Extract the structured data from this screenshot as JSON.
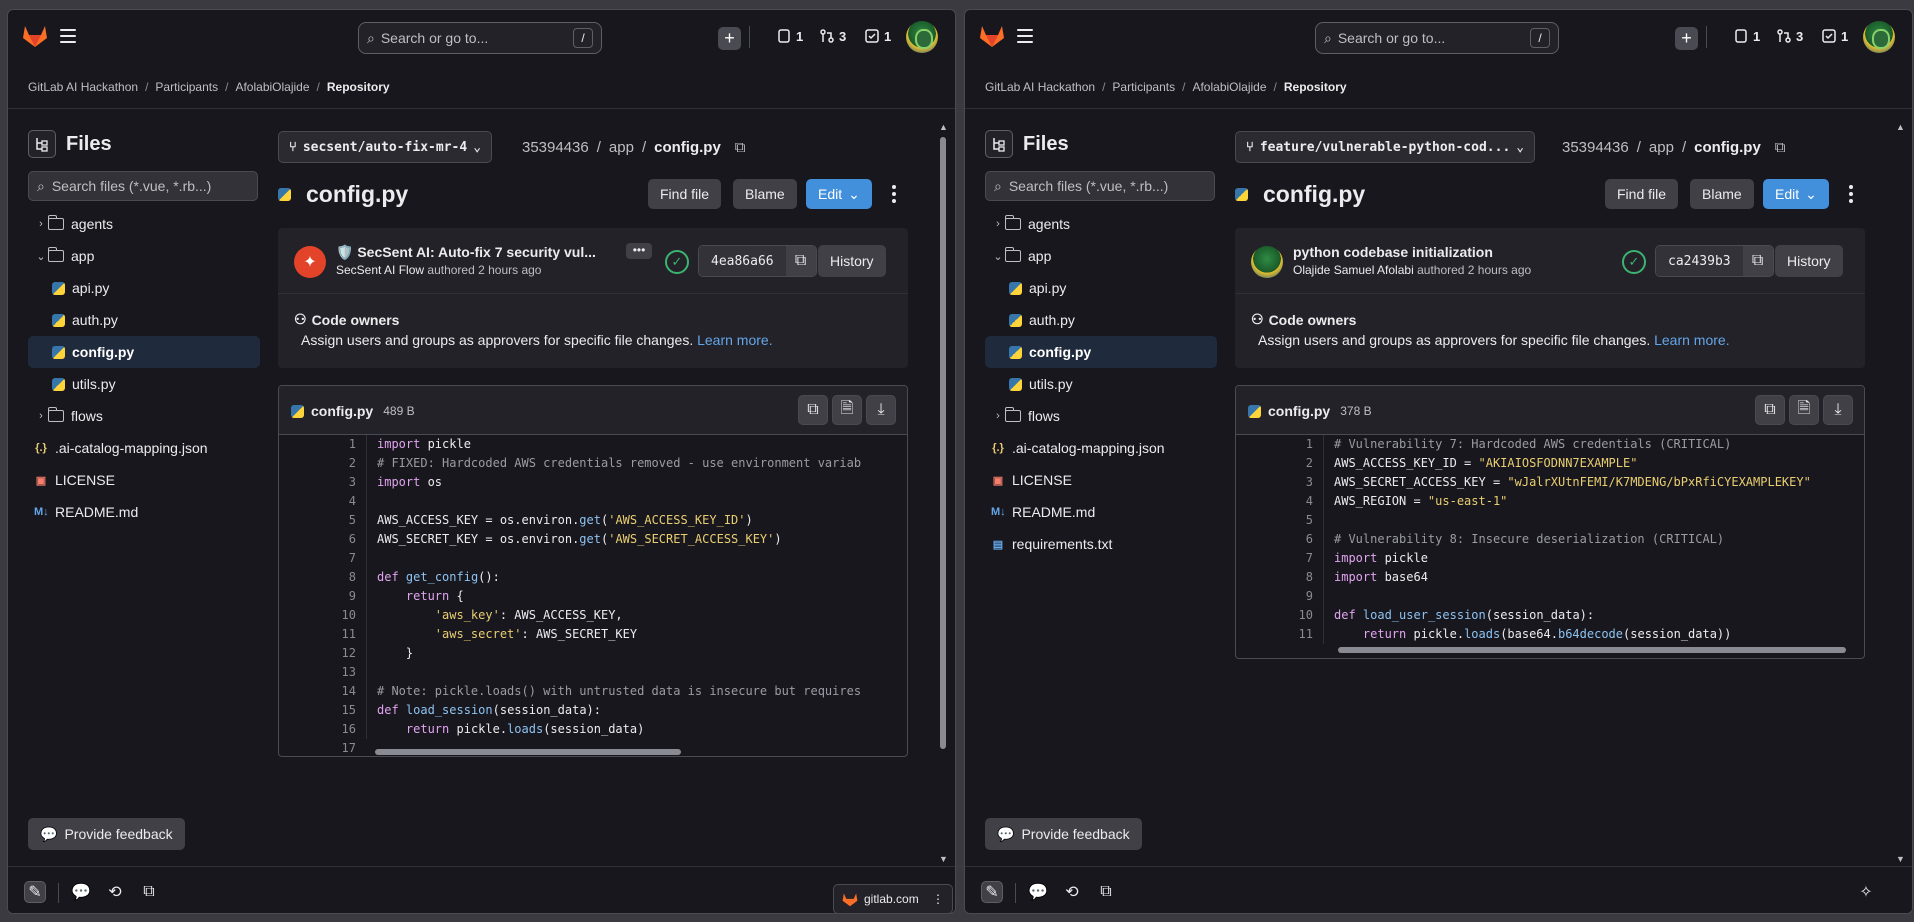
{
  "header": {
    "search_placeholder": "Search or go to...",
    "search_shortcut": "/",
    "issues_count": "1",
    "mr_count": "3",
    "todo_count": "1"
  },
  "breadcrumb": [
    "GitLab AI Hackathon",
    "Participants",
    "AfolabiOlajide",
    "Repository"
  ],
  "sidebar": {
    "title": "Files",
    "search_placeholder": "Search files (*.vue, *.rb...)"
  },
  "left": {
    "branch": "secsent/auto-fix-mr-4",
    "project_id": "35394436",
    "path_dir": "app",
    "path_file": "config.py",
    "file_title": "config.py",
    "tree": [
      {
        "type": "folder",
        "label": "agents",
        "expanded": false
      },
      {
        "type": "folder",
        "label": "app",
        "expanded": true
      },
      {
        "type": "py",
        "label": "api.py",
        "indent": true
      },
      {
        "type": "py",
        "label": "auth.py",
        "indent": true
      },
      {
        "type": "py",
        "label": "config.py",
        "indent": true,
        "selected": true
      },
      {
        "type": "py",
        "label": "utils.py",
        "indent": true
      },
      {
        "type": "folder",
        "label": "flows",
        "expanded": false
      },
      {
        "type": "json",
        "label": ".ai-catalog-mapping.json"
      },
      {
        "type": "license",
        "label": "LICENSE"
      },
      {
        "type": "md",
        "label": "README.md"
      }
    ],
    "commit": {
      "title": "🛡️ SecSent AI: Auto-fix 7 security vul...",
      "author": "SecSent AI Flow",
      "authored": "authored 2 hours ago",
      "sha": "4ea86a66"
    },
    "blob_name": "config.py",
    "blob_size": "489 B",
    "line_count": 17
  },
  "right": {
    "branch": "feature/vulnerable-python-cod...",
    "project_id": "35394436",
    "path_dir": "app",
    "path_file": "config.py",
    "file_title": "config.py",
    "tree": [
      {
        "type": "folder",
        "label": "agents",
        "expanded": false
      },
      {
        "type": "folder",
        "label": "app",
        "expanded": true
      },
      {
        "type": "py",
        "label": "api.py",
        "indent": true
      },
      {
        "type": "py",
        "label": "auth.py",
        "indent": true
      },
      {
        "type": "py",
        "label": "config.py",
        "indent": true,
        "selected": true
      },
      {
        "type": "py",
        "label": "utils.py",
        "indent": true
      },
      {
        "type": "folder",
        "label": "flows",
        "expanded": false
      },
      {
        "type": "json",
        "label": ".ai-catalog-mapping.json"
      },
      {
        "type": "license",
        "label": "LICENSE"
      },
      {
        "type": "md",
        "label": "README.md"
      },
      {
        "type": "txt",
        "label": "requirements.txt"
      }
    ],
    "commit": {
      "title": "python codebase initialization",
      "author": "Olajide Samuel Afolabi",
      "authored": "authored 2 hours ago",
      "sha": "ca2439b3"
    },
    "blob_name": "config.py",
    "blob_size": "378 B",
    "line_count": 11
  },
  "actions": {
    "find_file": "Find file",
    "blame": "Blame",
    "edit": "Edit",
    "history": "History",
    "code_owners_title": "Code owners",
    "code_owners_text": "Assign users and groups as approvers for specific file changes.",
    "learn_more": "Learn more.",
    "feedback": "Provide feedback"
  },
  "taskbar_pill": "gitlab.com",
  "colors": {
    "accent": "#428fdc",
    "bg": "#18171d",
    "success": "#3cb371",
    "brand": "#fc6d26"
  }
}
